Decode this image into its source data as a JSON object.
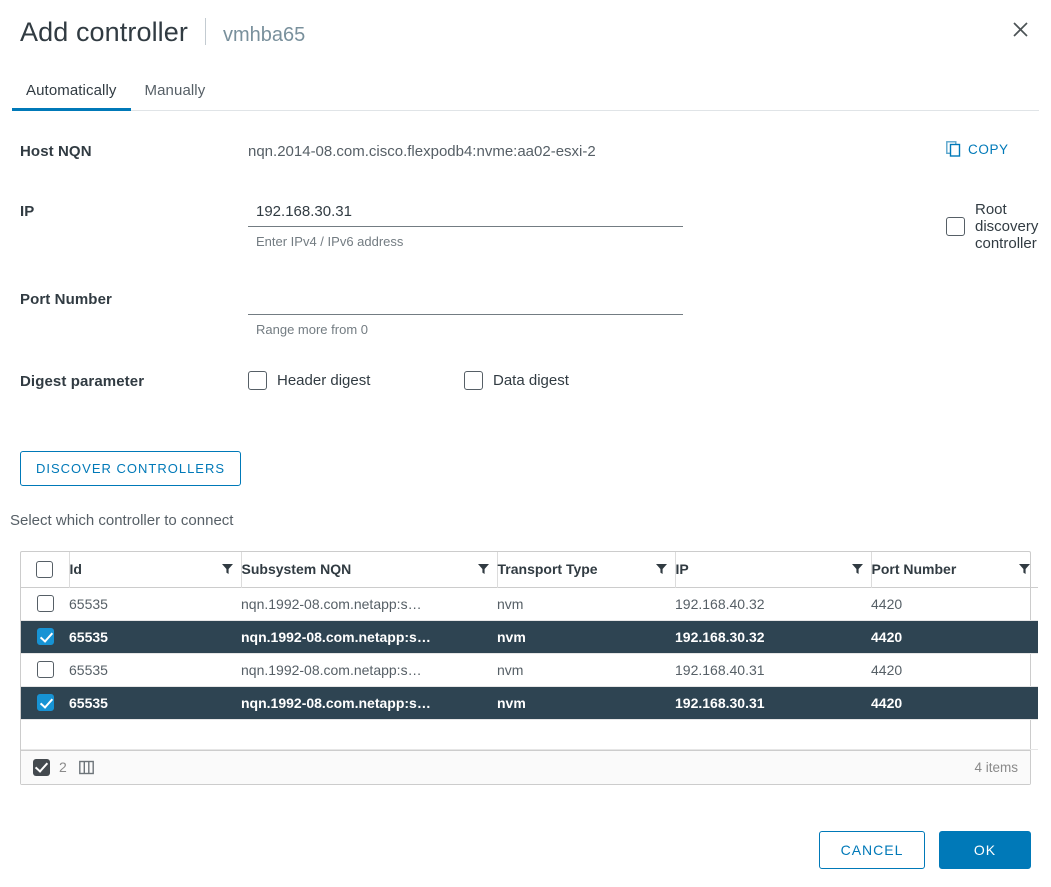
{
  "header": {
    "title": "Add controller",
    "subtitle": "vmhba65",
    "close_icon": "close-icon"
  },
  "tabs": [
    {
      "label": "Automatically",
      "active": true
    },
    {
      "label": "Manually",
      "active": false
    }
  ],
  "form": {
    "host_nqn": {
      "label": "Host NQN",
      "value": "nqn.2014-08.com.cisco.flexpodb4:nvme:aa02-esxi-2",
      "copy_label": "COPY"
    },
    "ip": {
      "label": "IP",
      "value": "192.168.30.31",
      "placeholder": "",
      "helper": "Enter IPv4 / IPv6 address"
    },
    "root_discovery": {
      "label": "Root discovery controller",
      "checked": false
    },
    "port_number": {
      "label": "Port Number",
      "value": "",
      "placeholder": "",
      "helper": "Range more from 0"
    },
    "digest": {
      "label": "Digest parameter",
      "options": [
        {
          "label": "Header digest",
          "checked": false
        },
        {
          "label": "Data digest",
          "checked": false
        }
      ]
    }
  },
  "discover_button": "DISCOVER CONTROLLERS",
  "select_hint": "Select which controller to connect",
  "table": {
    "columns": [
      {
        "key": "id",
        "label": "Id"
      },
      {
        "key": "nqn",
        "label": "Subsystem NQN"
      },
      {
        "key": "transport",
        "label": "Transport Type"
      },
      {
        "key": "ip",
        "label": "IP"
      },
      {
        "key": "port",
        "label": "Port Number"
      }
    ],
    "rows": [
      {
        "selected": false,
        "id": "65535",
        "nqn": "nqn.1992-08.com.netapp:s…",
        "transport": "nvm",
        "ip": "192.168.40.32",
        "port": "4420"
      },
      {
        "selected": true,
        "id": "65535",
        "nqn": "nqn.1992-08.com.netapp:s…",
        "transport": "nvm",
        "ip": "192.168.30.32",
        "port": "4420"
      },
      {
        "selected": false,
        "id": "65535",
        "nqn": "nqn.1992-08.com.netapp:s…",
        "transport": "nvm",
        "ip": "192.168.40.31",
        "port": "4420"
      },
      {
        "selected": true,
        "id": "65535",
        "nqn": "nqn.1992-08.com.netapp:s…",
        "transport": "nvm",
        "ip": "192.168.30.31",
        "port": "4420"
      }
    ],
    "footer": {
      "selected_count": "2",
      "items_label": "4 items",
      "columns_icon": "columns-icon"
    }
  },
  "actions": {
    "cancel": "CANCEL",
    "ok": "OK"
  },
  "colors": {
    "accent": "#0079b8",
    "selected_row": "#2e4452",
    "checkbox_checked": "#1793d4",
    "text": "#313b42",
    "muted": "#737c82"
  }
}
